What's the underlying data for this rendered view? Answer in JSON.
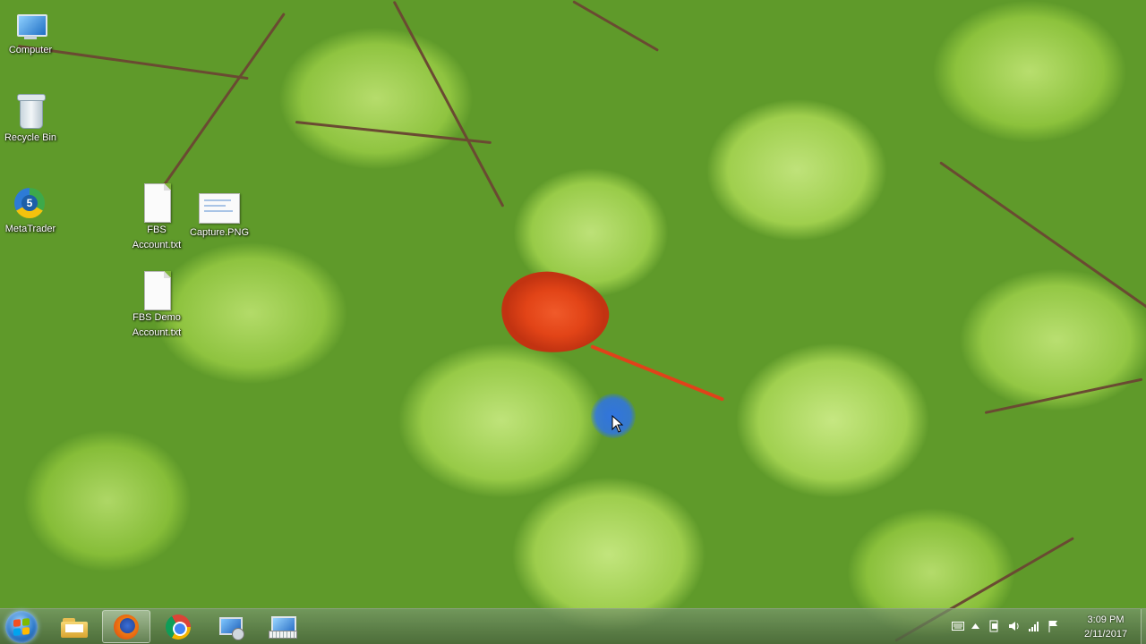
{
  "desktop": {
    "icons": [
      {
        "label": "Computer"
      },
      {
        "label": "Recycle Bin"
      },
      {
        "label": "MetaTrader"
      },
      {
        "label_line1": "FBS",
        "label_line2": "Account.txt"
      },
      {
        "label": "Capture.PNG"
      },
      {
        "label_line1": "FBS Demo",
        "label_line2": "Account.txt"
      }
    ],
    "metatrader_badge": "5"
  },
  "taskbar": {
    "apps": [
      {
        "icon": "windows-explorer-icon"
      },
      {
        "icon": "firefox-icon",
        "active": true
      },
      {
        "icon": "chrome-icon"
      },
      {
        "icon": "network-computer-icon"
      },
      {
        "icon": "on-screen-keyboard-icon"
      }
    ],
    "tray": {
      "icons": [
        "keyboard-layout-icon",
        "show-hidden-icons-arrow",
        "action-center-flag-icon",
        "volume-icon",
        "network-signal-icon",
        "flag-icon"
      ],
      "time": "3:09 PM",
      "date": "2/11/2017"
    }
  },
  "colors": {
    "leaf_green": "#9fcf4d",
    "flower_red": "#e24417",
    "cursor_halo": "#2a6eff"
  }
}
